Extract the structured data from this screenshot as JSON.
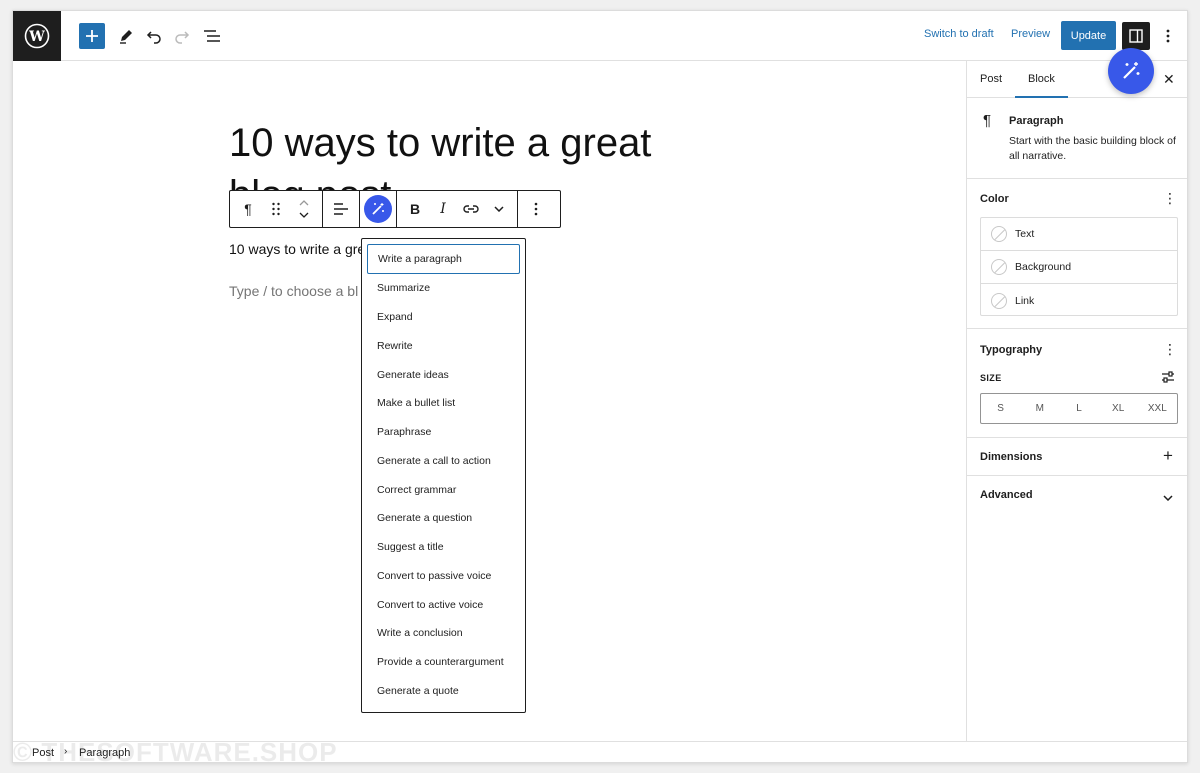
{
  "toolbar": {
    "switch_to_draft": "Switch to draft",
    "preview": "Preview",
    "update": "Update"
  },
  "post": {
    "title": "10 ways to write a great blog post",
    "paragraph": "10 ways to write a gre",
    "placeholder": "Type / to choose a bl"
  },
  "ai_menu": {
    "items": [
      "Write a paragraph",
      "Summarize",
      "Expand",
      "Rewrite",
      "Generate ideas",
      "Make a bullet list",
      "Paraphrase",
      "Generate a call to action",
      "Correct grammar",
      "Generate a question",
      "Suggest a title",
      "Convert to passive voice",
      "Convert to active voice",
      "Write a conclusion",
      "Provide a counterargument",
      "Generate a quote"
    ]
  },
  "sidebar": {
    "tabs": [
      "Post",
      "Block"
    ],
    "block_name": "Paragraph",
    "block_desc": "Start with the basic building block of all narrative.",
    "color_title": "Color",
    "color_items": [
      "Text",
      "Background",
      "Link"
    ],
    "typography_title": "Typography",
    "size_label": "SIZE",
    "sizes": [
      "S",
      "M",
      "L",
      "XL",
      "XXL"
    ],
    "dimensions_title": "Dimensions",
    "advanced_title": "Advanced"
  },
  "breadcrumb": [
    "Post",
    "Paragraph"
  ],
  "watermark": "© THESOFTWARE.SHOP",
  "colors": {
    "accent": "#2271b1",
    "ai_blue": "#3858e9",
    "dark": "#1e1e1e"
  }
}
